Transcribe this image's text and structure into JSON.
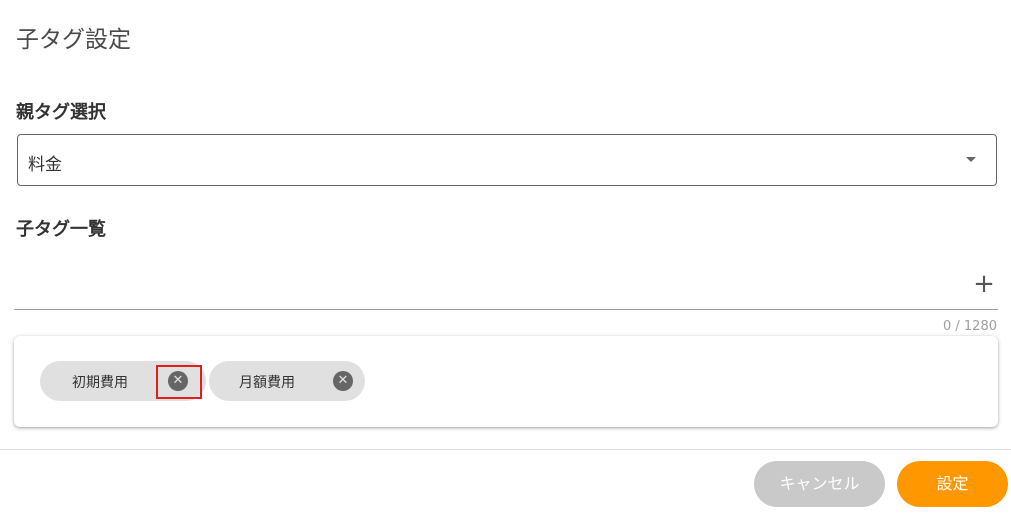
{
  "dialog": {
    "title": "子タグ設定"
  },
  "parent_tag": {
    "label": "親タグ選択",
    "selected_value": "料金"
  },
  "child_tags": {
    "label": "子タグ一覧",
    "input_value": "",
    "add_icon": "+",
    "counter": "0 / 1280",
    "chips": [
      {
        "label": "初期費用"
      },
      {
        "label": "月額費用"
      }
    ],
    "chip_close_icon": "✕"
  },
  "actions": {
    "cancel_label": "キャンセル",
    "submit_label": "設定"
  },
  "colors": {
    "accent": "#ff9800",
    "cancel": "#c9c9c9",
    "highlight": "#e02020"
  }
}
